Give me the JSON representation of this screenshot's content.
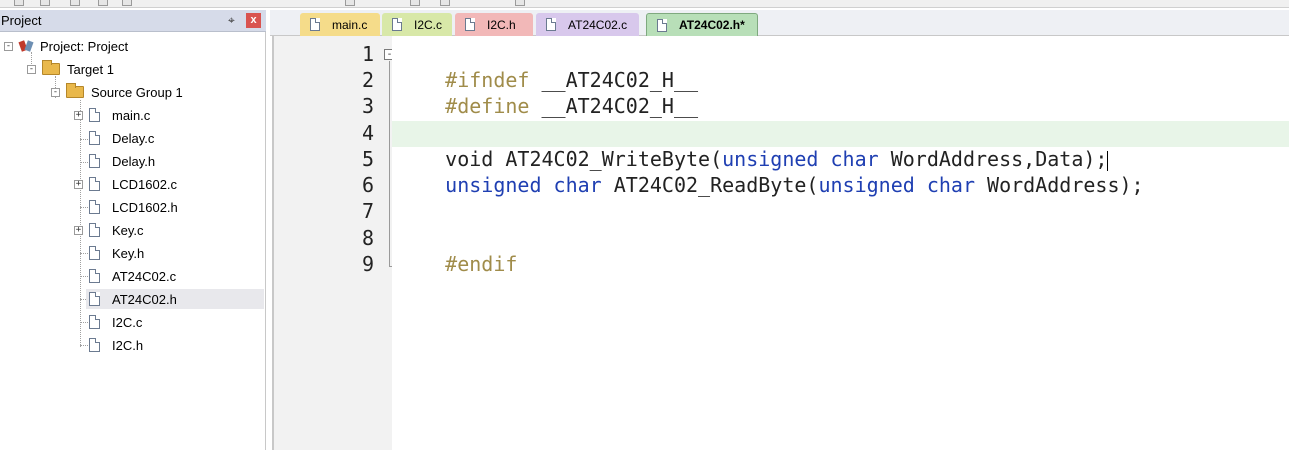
{
  "project_panel": {
    "title": "Project",
    "pin": "⌖",
    "close": "x",
    "tree": {
      "root": "Project: Project",
      "target": "Target 1",
      "group": "Source Group 1",
      "files": [
        "main.c",
        "Delay.c",
        "Delay.h",
        "LCD1602.c",
        "LCD1602.h",
        "Key.c",
        "Key.h",
        "AT24C02.c",
        "AT24C02.h",
        "I2C.c",
        "I2C.h"
      ],
      "expander_plus": "+",
      "expander_minus": "-",
      "selected_file": "AT24C02.h"
    }
  },
  "tabs": [
    {
      "label": "main.c",
      "color": "#f5dc8a"
    },
    {
      "label": "I2C.c",
      "color": "#d8e8a8"
    },
    {
      "label": "I2C.h",
      "color": "#f2b8b8"
    },
    {
      "label": "AT24C02.c",
      "color": "#d8c8ec"
    },
    {
      "label": "AT24C02.h*",
      "color": "#b8dfb8",
      "active": true
    }
  ],
  "editor": {
    "line_numbers": [
      "1",
      "2",
      "3",
      "4",
      "5",
      "6",
      "7",
      "8",
      "9"
    ],
    "fold_minus": "-",
    "current_line": 4,
    "line1": {
      "directive": "#ifndef",
      "name": "__AT24C02_H__"
    },
    "line2": {
      "directive": "#define",
      "name": "__AT24C02_H__"
    },
    "line4": {
      "t1": "void",
      "t2": " AT24C02_WriteByte(",
      "t3": "unsigned",
      "t4": " ",
      "t5": "char",
      "t6": " WordAddress,Data);"
    },
    "line5": {
      "t1": "unsigned",
      "t2": " ",
      "t3": "char",
      "t4": " AT24C02_ReadByte(",
      "t5": "unsigned",
      "t6": " ",
      "t7": "char",
      "t8": " WordAddress);"
    },
    "line8": {
      "directive": "#endif"
    }
  },
  "colors": {
    "preprocessor": "#a08c4a",
    "keyword": "#1f3fb2",
    "current_line_bg": "#e8f5e8",
    "panel_header": "#d6dbe9"
  }
}
